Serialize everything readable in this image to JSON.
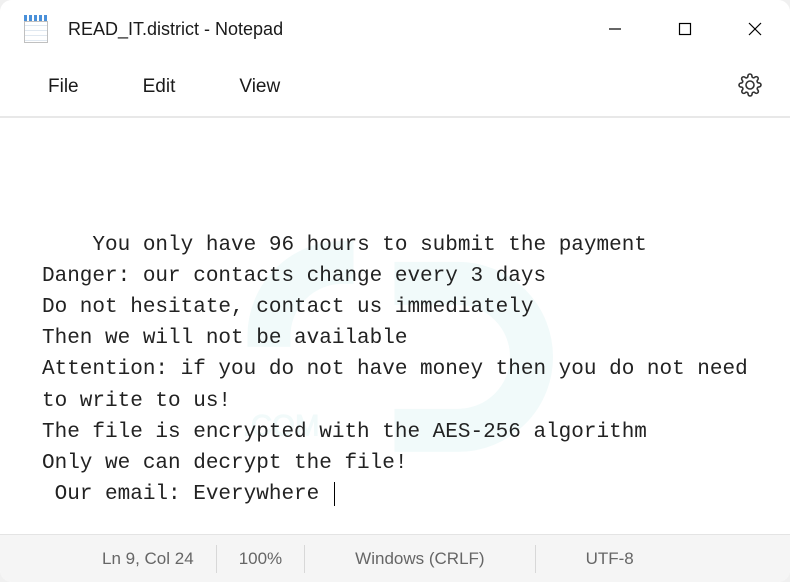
{
  "titlebar": {
    "title": "READ_IT.district - Notepad"
  },
  "menubar": {
    "file": "File",
    "edit": "Edit",
    "view": "View"
  },
  "editor": {
    "content": "You only have 96 hours to submit the payment\nDanger: our contacts change every 3 days\nDo not hesitate, contact us immediately\nThen we will not be available\nAttention: if you do not have money then you do not need to write to us!\nThe file is encrypted with the AES-256 algorithm\nOnly we can decrypt the file!\n Our email: Everywhere "
  },
  "statusbar": {
    "position": "Ln 9, Col 24",
    "zoom": "100%",
    "line_ending": "Windows (CRLF)",
    "encoding": "UTF-8"
  }
}
